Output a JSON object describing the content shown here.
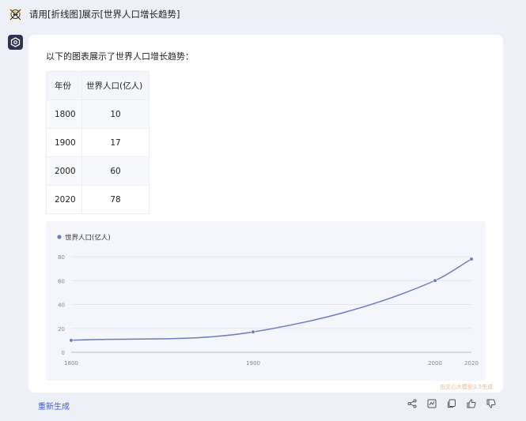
{
  "user_message": "请用[折线图]展示[世界人口增长趋势]",
  "assistant": {
    "intro": "以下的图表展示了世界人口增长趋势：",
    "table": {
      "headers": [
        "年份",
        "世界人口(亿人)"
      ],
      "rows": [
        [
          "1800",
          "10"
        ],
        [
          "1900",
          "17"
        ],
        [
          "2000",
          "60"
        ],
        [
          "2020",
          "78"
        ]
      ]
    },
    "watermark": "由文心大模型3.5生成"
  },
  "actions": {
    "regenerate_label": "重新生成",
    "icons": [
      "share-icon",
      "chart-icon",
      "copy-icon",
      "thumbs-up-icon",
      "thumbs-down-icon"
    ]
  },
  "chart_data": {
    "type": "line",
    "x": [
      1800,
      1900,
      2000,
      2020
    ],
    "series": [
      {
        "name": "世界人口(亿人)",
        "values": [
          10,
          17,
          60,
          78
        ],
        "color": "#6b7cc4"
      }
    ],
    "x_ticks": [
      "1800",
      "1900",
      "2000",
      "2020"
    ],
    "y_ticks": [
      "0",
      "20",
      "40",
      "60",
      "80"
    ],
    "ylim": [
      0,
      80
    ],
    "legend_position": "top-left",
    "grid": true,
    "smooth": true
  }
}
